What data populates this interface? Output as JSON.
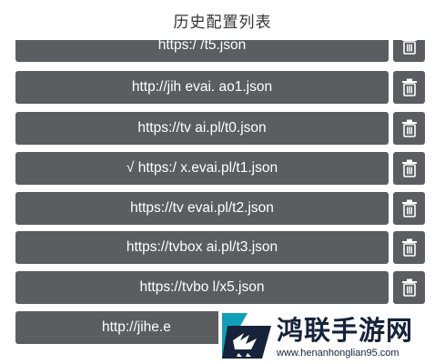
{
  "header": {
    "title": "历史配置列表"
  },
  "items": [
    {
      "url": "https:/                /t5.json"
    },
    {
      "url": "http://jih         evai.        ao1.json"
    },
    {
      "url": "https://tv             ai.pl/t0.json"
    },
    {
      "url": "√ https:/            x.evai.pl/t1.json"
    },
    {
      "url": "https://tv          evai.pl/t2.json"
    },
    {
      "url": "https://tvbox      ai.pl/t3.json"
    },
    {
      "url": "https://tvbo            l/x5.json"
    },
    {
      "url": "http://jihe.e"
    }
  ],
  "watermark": {
    "text": "鸿联手游网",
    "url": "www.henanhonglian95.com"
  },
  "icons": {
    "delete": "trash-icon"
  },
  "colors": {
    "button_bg": "#5c5d61",
    "button_text": "#ffffff",
    "brand": "#16233b"
  }
}
